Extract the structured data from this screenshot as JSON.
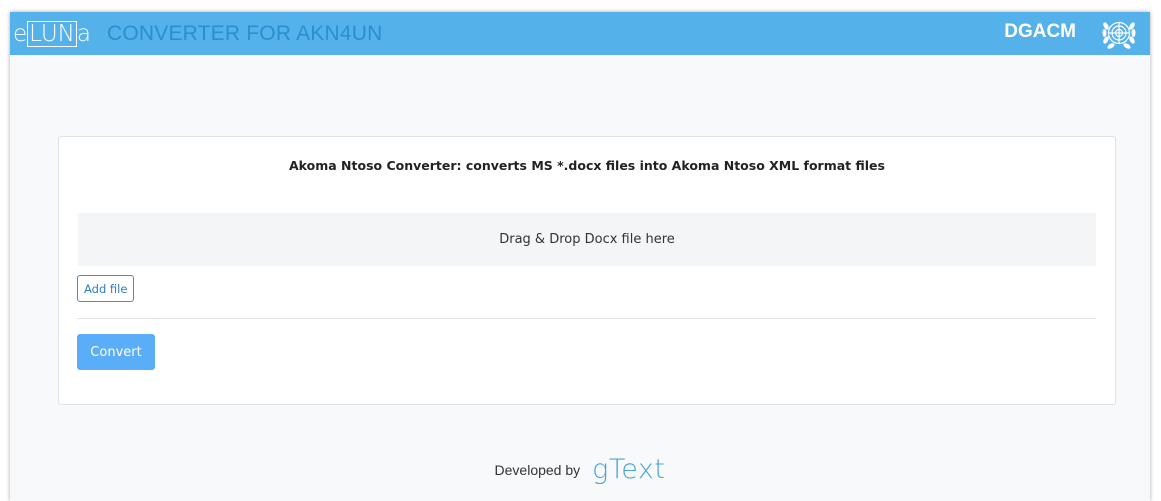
{
  "header": {
    "logo": {
      "prefix": "e",
      "boxed": "LUN",
      "suffix": "a"
    },
    "app_title": "CONVERTER FOR AKN4UN",
    "org_code": "DGACM",
    "emblem_icon": "un-emblem-icon",
    "bar_color": "#55b1ea"
  },
  "main": {
    "title": "Akoma Ntoso Converter: converts MS *.docx files into Akoma Ntoso XML format files",
    "dropzone_text": "Drag & Drop Docx file here",
    "add_file_label": "Add file",
    "convert_label": "Convert",
    "convert_color": "#5aaef7"
  },
  "footer": {
    "developed_by": "Developed by",
    "brand": "gText"
  }
}
